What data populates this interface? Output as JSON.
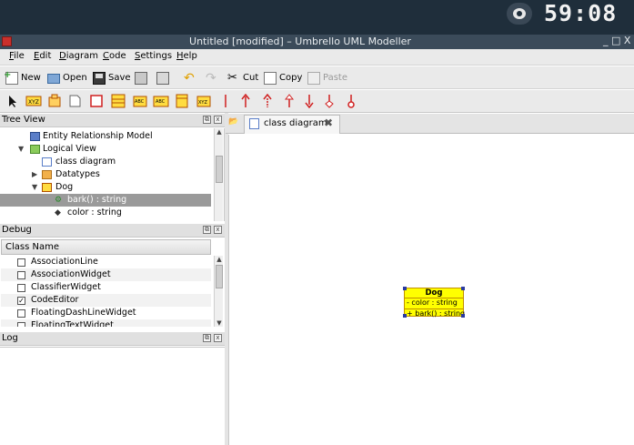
{
  "clock": {
    "time": "59:08"
  },
  "window": {
    "title": "Untitled [modified] – Umbrello UML Modeller",
    "controls": "_ □ X"
  },
  "menu": [
    "File",
    "Edit",
    "Diagram",
    "Code",
    "Settings",
    "Help"
  ],
  "toolbar": {
    "new": "New",
    "open": "Open",
    "save": "Save",
    "cut": "Cut",
    "copy": "Copy",
    "paste": "Paste"
  },
  "tree_view": {
    "title": "Tree View",
    "items": [
      {
        "label": "Entity Relationship Model",
        "indent": 0,
        "icon": "folder-blue-icon"
      },
      {
        "label": "Logical View",
        "indent": 0,
        "icon": "folder-green-icon"
      },
      {
        "label": "class diagram",
        "indent": 1,
        "icon": "diagram-icon"
      },
      {
        "label": "Datatypes",
        "indent": 1,
        "icon": "folder-icon"
      },
      {
        "label": "Dog",
        "indent": 1,
        "icon": "class-icon"
      },
      {
        "label": "bark() : string",
        "indent": 2,
        "icon": "operation-icon",
        "selected": true
      },
      {
        "label": "color : string",
        "indent": 2,
        "icon": "attribute-icon"
      }
    ]
  },
  "debug": {
    "title": "Debug",
    "column": "Class Name",
    "rows": [
      {
        "label": "AssociationLine",
        "checked": false
      },
      {
        "label": "AssociationWidget",
        "checked": false
      },
      {
        "label": "ClassifierWidget",
        "checked": false
      },
      {
        "label": "CodeEditor",
        "checked": true
      },
      {
        "label": "FloatingDashLineWidget",
        "checked": false
      },
      {
        "label": "FloatingTextWidget",
        "checked": false
      }
    ]
  },
  "log": {
    "title": "Log"
  },
  "diagram_tab": {
    "label": "class diagram"
  },
  "uml_class": {
    "name": "Dog",
    "attribute": "- color : string",
    "operation": "+ bark() : string"
  },
  "colors": {
    "class_fill": "#ffff00",
    "selection": "#9a9a9a",
    "titlebar": "#3b4b5a"
  }
}
